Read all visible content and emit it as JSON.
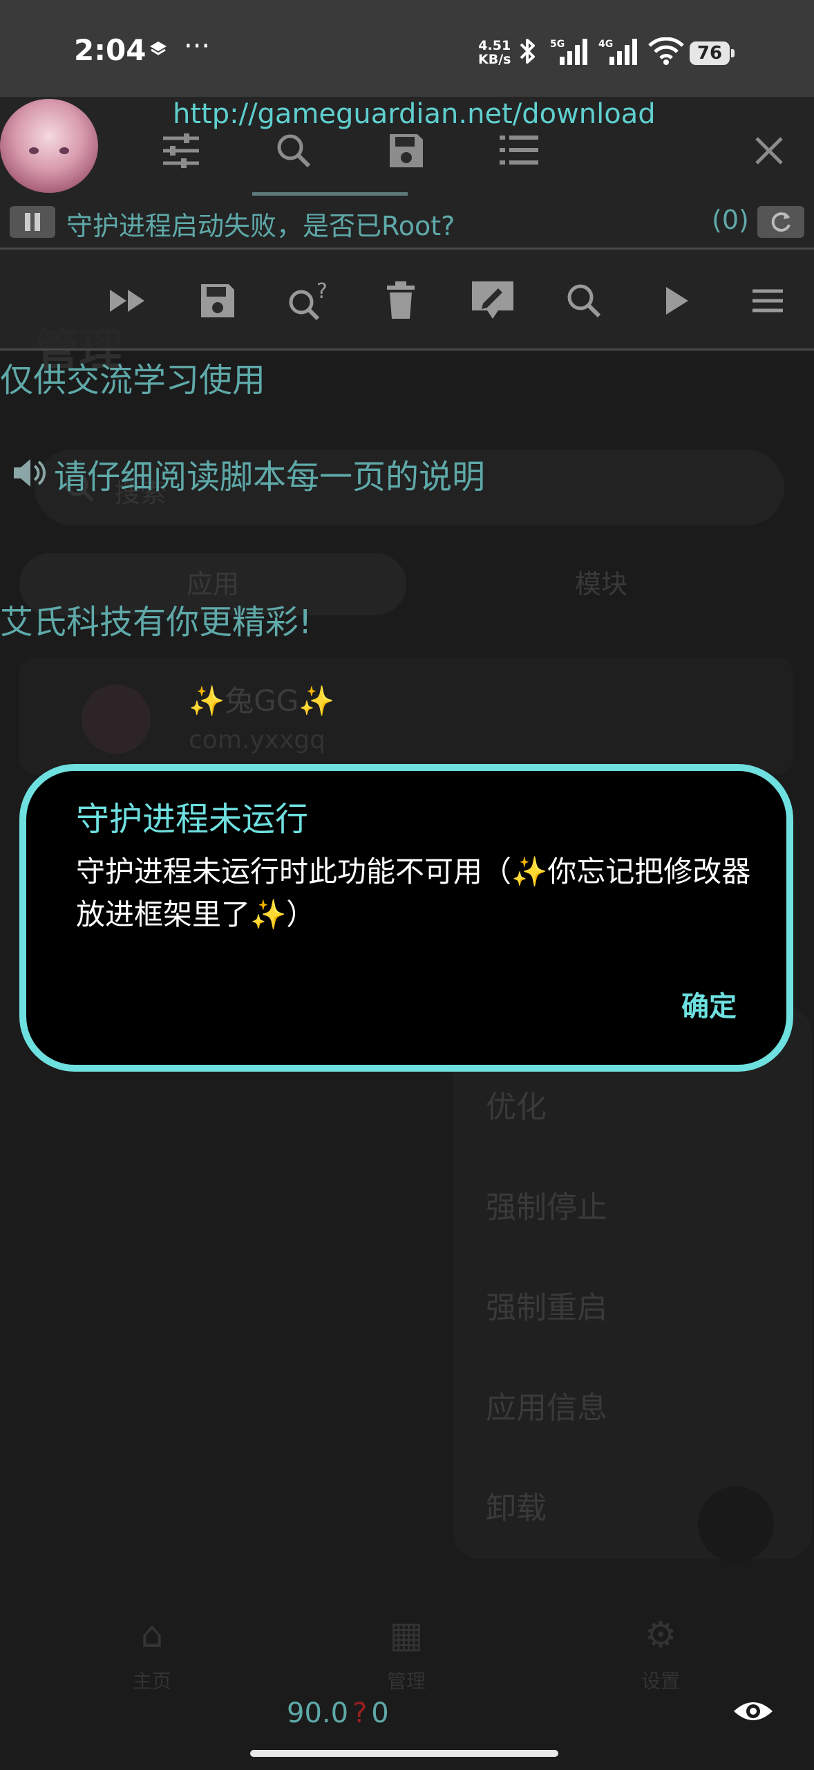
{
  "status_bar": {
    "time": "2:04",
    "more": "···",
    "net_speed_value": "4.51",
    "net_speed_unit": "KB/s",
    "sig1_label": "5G",
    "sig2_label": "4G",
    "battery": "76"
  },
  "background_app": {
    "title": "管理",
    "search_placeholder": "搜索",
    "tabs": [
      "应用",
      "模块"
    ],
    "app_card": {
      "name": "✨兔GG✨",
      "package": "com.yxxgq"
    },
    "menu_items": [
      "优化",
      "强制停止",
      "强制重启",
      "应用信息",
      "卸载"
    ],
    "nav": {
      "home": "主页",
      "manage": "管理",
      "settings": "设置"
    }
  },
  "gg_overlay": {
    "url": "http://gameguardian.net/download",
    "status_message": "守护进程启动失败，是否已Root?",
    "result_count": "(0)",
    "script_lines": [
      "仅供交流学习使用",
      "请仔细阅读脚本每一页的说明",
      "艾氏科技有你更精彩!"
    ],
    "speed_value": "90.0",
    "speed_unknown": "?",
    "speed_count": "0"
  },
  "dialog": {
    "title": "守护进程未运行",
    "message": "守护进程未运行时此功能不可用（✨你忘记把修改器放进框架里了✨）",
    "ok_label": "确定"
  },
  "colors": {
    "accent": "#6fe0e0",
    "overlay_text": "#5fa9a9",
    "background": "#1b1b1b"
  }
}
